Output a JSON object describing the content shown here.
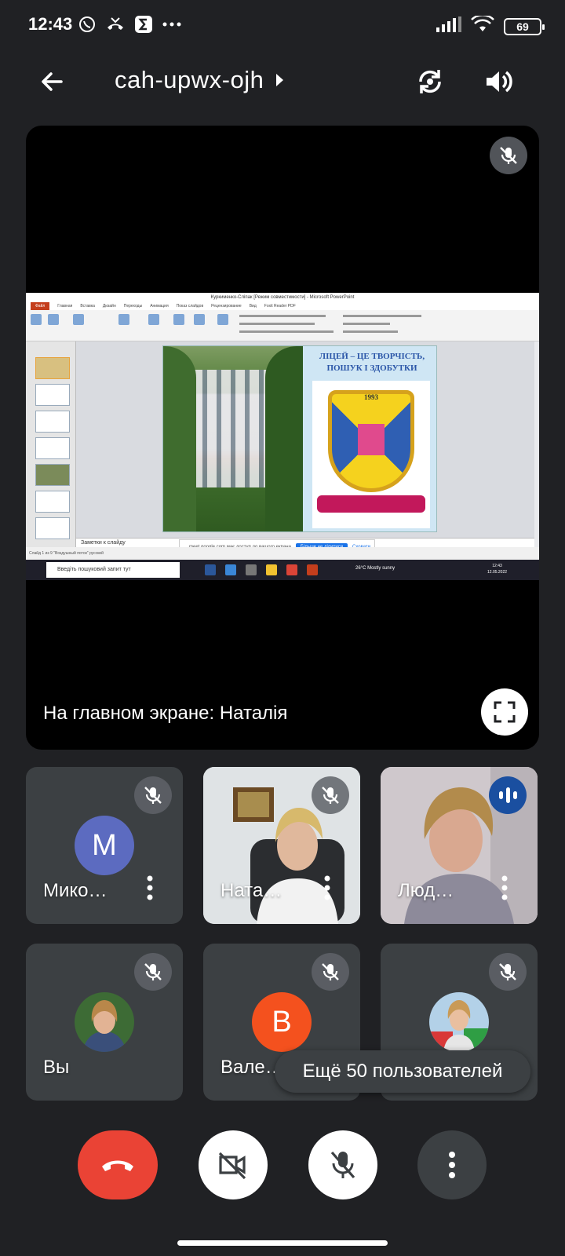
{
  "status_bar": {
    "time": "12:43",
    "battery": "69",
    "icons": [
      "viber-icon",
      "missed-call-icon",
      "sigma-icon",
      "more-dots-icon",
      "signal-icon",
      "wifi-icon",
      "battery-icon"
    ]
  },
  "header": {
    "meeting_code": "cah-upwx-ojh",
    "icons": [
      "back-arrow-icon",
      "chevron-right-icon",
      "switch-camera-icon",
      "speaker-icon"
    ]
  },
  "main_stage": {
    "label": "На главном экране: Наталія",
    "shared_screen": {
      "window_title": "Куркименко-Сліпак [Режим совместимости] - Microsoft PowerPoint",
      "tabs": [
        "Файл",
        "Главная",
        "Вставка",
        "Дизайн",
        "Переходы",
        "Анимация",
        "Показ слайдов",
        "Рецензирование",
        "Вид",
        "Foxit Reader PDF"
      ],
      "slide_title": "ЛІЦЕЙ – ЦЕ ТВОРЧІСТЬ, ПОШУК І ЗДОБУТКИ",
      "slide_year": "1993",
      "notes_placeholder": "Заметки к слайду",
      "share_notice": "meet.google.com має доступ до вашого екрана",
      "share_stop": "Більше не ділитися",
      "share_hide": "Сховати",
      "status_text": "Слайд 1 из 9   \"Воздушный поток\"   русский",
      "taskbar_search": "Введіть пошуковий запит тут",
      "weather": "26°C  Mostly sunny",
      "clock_time": "12:43",
      "clock_date": "12.05.2022"
    }
  },
  "participants": [
    {
      "name": "Мико…",
      "initial": "М",
      "avatar_color": "#5c6bc0",
      "type": "letter",
      "muted": true
    },
    {
      "name": "Ната…",
      "type": "video",
      "muted": true
    },
    {
      "name": "Люд…",
      "type": "video",
      "speaking": true
    },
    {
      "name": "Вы",
      "type": "photo",
      "muted": true
    },
    {
      "name": "Вале…",
      "initial": "В",
      "avatar_color": "#f4511e",
      "type": "letter",
      "muted": true
    },
    {
      "name": "",
      "type": "photo",
      "muted": true
    }
  ],
  "more_users_label": "Ещё 50 пользователей",
  "controls": [
    "end-call-button",
    "camera-off-button",
    "mic-off-button",
    "more-options-button"
  ],
  "colors": {
    "background": "#202124",
    "tile": "#3c4043",
    "end_call": "#ea4335",
    "speaking": "#1a4fa0"
  }
}
